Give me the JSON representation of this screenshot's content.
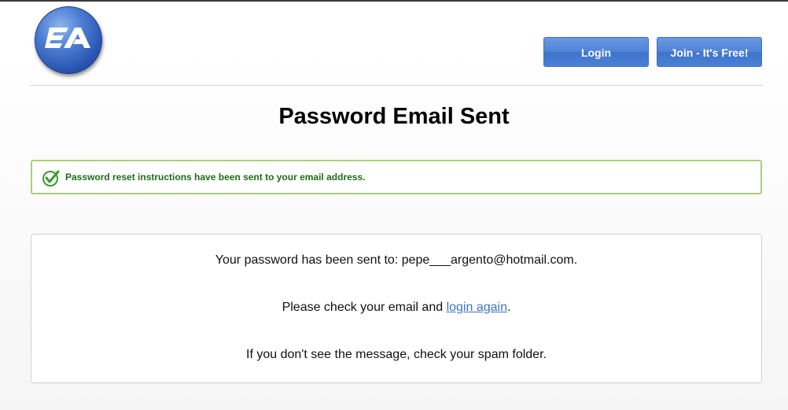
{
  "header": {
    "logo_text": "EA",
    "login_label": "Login",
    "join_label": "Join - It's Free!"
  },
  "main": {
    "title": "Password Email Sent",
    "success_message": "Password reset instructions have been sent to your email address.",
    "sent_to_prefix": "Your password has been sent to: ",
    "email": "pepe___argento@hotmail.com",
    "sent_to_suffix": ".",
    "check_prefix": "Please check your email and ",
    "login_again_link": "login again",
    "check_suffix": ".",
    "spam_note": "If you don't see the message, check your spam folder."
  },
  "colors": {
    "button_blue": "#4f83d6",
    "success_border": "#a8d07a",
    "success_text": "#1f6b1a",
    "link": "#3b73c8"
  },
  "icons": {
    "logo": "ea-logo-icon",
    "success": "check-circle-icon"
  }
}
